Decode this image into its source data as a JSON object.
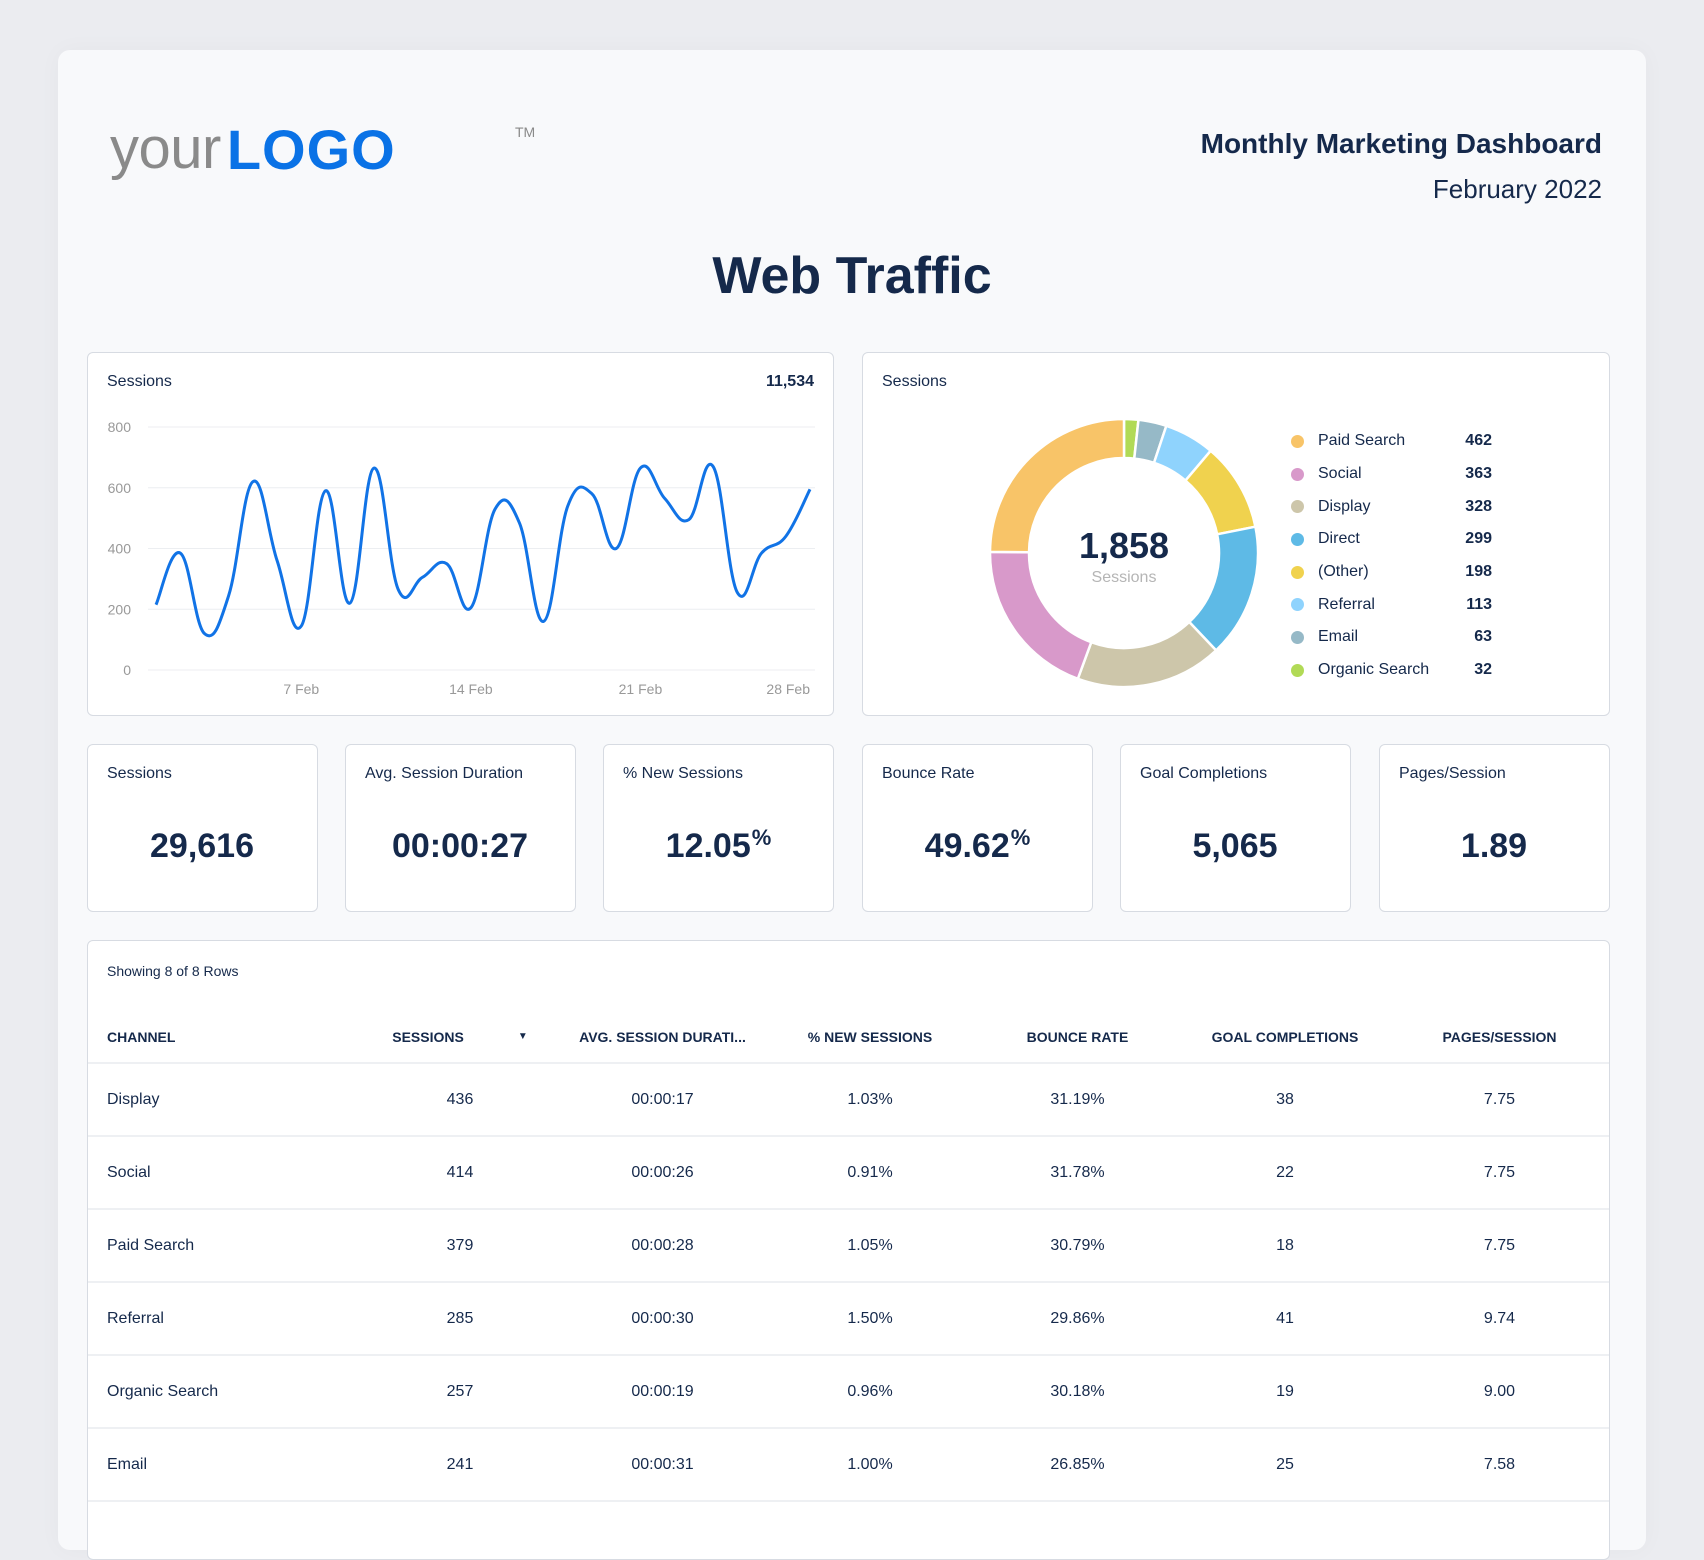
{
  "logo": {
    "your": "your",
    "logo": "LOGO",
    "tm": "TM"
  },
  "header": {
    "title": "Monthly Marketing Dashboard",
    "date": "February 2022"
  },
  "page_title": "Web Traffic",
  "colors": {
    "accent": "#0a72e6",
    "text": "#15294b",
    "line": "#1173e6"
  },
  "line_card": {
    "label": "Sessions",
    "total": "11,534"
  },
  "donut_card": {
    "label": "Sessions",
    "center_value": "1,858",
    "center_label": "Sessions"
  },
  "kpis": [
    {
      "label": "Sessions",
      "value": "29,616",
      "suffix": ""
    },
    {
      "label": "Avg. Session Duration",
      "value": "00:00:27",
      "suffix": ""
    },
    {
      "label": "% New Sessions",
      "value": "12.05",
      "suffix": "%"
    },
    {
      "label": "Bounce Rate",
      "value": "49.62",
      "suffix": "%"
    },
    {
      "label": "Goal Completions",
      "value": "5,065",
      "suffix": ""
    },
    {
      "label": "Pages/Session",
      "value": "1.89",
      "suffix": ""
    }
  ],
  "table": {
    "caption": "Showing 8 of 8 Rows",
    "sort_icon": "caret-down-icon",
    "columns": [
      "Channel",
      "Sessions",
      "Avg. Session Durati...",
      "% New Sessions",
      "Bounce Rate",
      "Goal Completions",
      "Pages/Session"
    ],
    "rows": [
      [
        "Display",
        "436",
        "00:00:17",
        "1.03%",
        "31.19%",
        "38",
        "7.75"
      ],
      [
        "Social",
        "414",
        "00:00:26",
        "0.91%",
        "31.78%",
        "22",
        "7.75"
      ],
      [
        "Paid Search",
        "379",
        "00:00:28",
        "1.05%",
        "30.79%",
        "18",
        "7.75"
      ],
      [
        "Referral",
        "285",
        "00:00:30",
        "1.50%",
        "29.86%",
        "41",
        "9.74"
      ],
      [
        "Organic Search",
        "257",
        "00:00:19",
        "0.96%",
        "30.18%",
        "19",
        "9.00"
      ],
      [
        "Email",
        "241",
        "00:00:31",
        "1.00%",
        "26.85%",
        "25",
        "7.58"
      ]
    ]
  },
  "chart_data": [
    {
      "type": "line",
      "title": "Sessions",
      "total_label": "11,534",
      "xlabel": "",
      "ylabel": "",
      "x": [
        1,
        2,
        3,
        4,
        5,
        6,
        7,
        8,
        9,
        10,
        11,
        12,
        13,
        14,
        15,
        16,
        17,
        18,
        19,
        20,
        21,
        22,
        23,
        24,
        25,
        26,
        27,
        28
      ],
      "x_unit": "Feb",
      "xtick_labels": [
        {
          "x": 7,
          "label": "7 Feb"
        },
        {
          "x": 14,
          "label": "14 Feb"
        },
        {
          "x": 21,
          "label": "21 Feb"
        },
        {
          "x": 28,
          "label": "28 Feb"
        }
      ],
      "series": [
        {
          "name": "Sessions",
          "values": [
            215,
            385,
            120,
            245,
            620,
            360,
            145,
            590,
            220,
            665,
            265,
            305,
            350,
            205,
            530,
            485,
            160,
            540,
            580,
            400,
            665,
            565,
            495,
            670,
            255,
            385,
            440,
            595
          ]
        }
      ],
      "yticks": [
        0,
        200,
        400,
        600,
        800
      ],
      "ylim": [
        0,
        800
      ],
      "grid": true
    },
    {
      "type": "pie",
      "variant": "donut",
      "title": "Sessions",
      "center_value": "1,858",
      "center_label": "Sessions",
      "legend_position": "right",
      "categories": [
        "Paid Search",
        "Social",
        "Display",
        "Direct",
        "(Other)",
        "Referral",
        "Email",
        "Organic Search"
      ],
      "values": [
        462,
        363,
        328,
        299,
        198,
        113,
        63,
        32
      ],
      "colors": [
        "#f8c468",
        "#d899ca",
        "#cdc6aa",
        "#5ebae6",
        "#f0d24e",
        "#8fd3fd",
        "#96b9c7",
        "#b1da56"
      ]
    }
  ]
}
